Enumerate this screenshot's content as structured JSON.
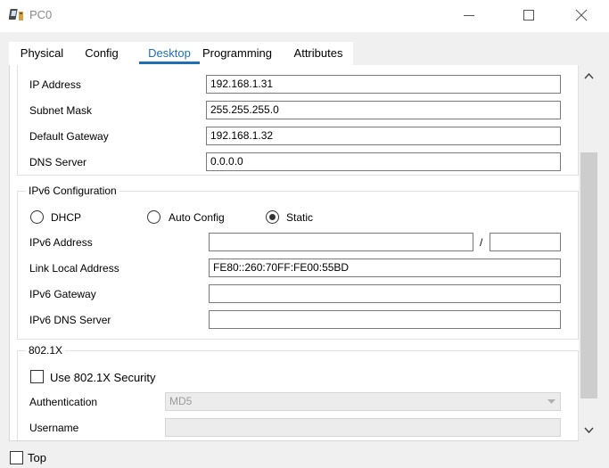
{
  "window": {
    "title": "PC0",
    "icon": "pc-app-icon",
    "controls": [
      "minimize-icon",
      "maximize-icon",
      "close-icon"
    ]
  },
  "tabs": [
    {
      "label": "Physical"
    },
    {
      "label": "Config"
    },
    {
      "label": "Desktop",
      "active": true
    },
    {
      "label": "Programming"
    },
    {
      "label": "Attributes"
    }
  ],
  "ipv4": {
    "ip_label": "IP Address",
    "ip_value": "192.168.1.31",
    "mask_label": "Subnet Mask",
    "mask_value": "255.255.255.0",
    "gateway_label": "Default Gateway",
    "gateway_value": "192.168.1.32",
    "dns_label": "DNS Server",
    "dns_value": "0.0.0.0"
  },
  "ipv6": {
    "title": "IPv6 Configuration",
    "dhcp_label": "DHCP",
    "auto_label": "Auto Config",
    "static_label": "Static",
    "selected_mode": "Static",
    "address_label": "IPv6 Address",
    "address_value": "",
    "prefix_value": "",
    "slash": "/",
    "link_local_label": "Link Local Address",
    "link_local_value": "FE80::260:70FF:FE00:55BD",
    "gateway_label": "IPv6 Gateway",
    "gateway_value": "",
    "dns_label": "IPv6 DNS Server",
    "dns_value": ""
  },
  "dot1x": {
    "title": "802.1X",
    "use_label": "Use 802.1X Security",
    "use_checked": false,
    "auth_label": "Authentication",
    "auth_value": "MD5",
    "username_label": "Username",
    "username_value": ""
  },
  "footer": {
    "top_label": "Top",
    "top_checked": false
  },
  "colors": {
    "accent": "#1f6fb5"
  }
}
